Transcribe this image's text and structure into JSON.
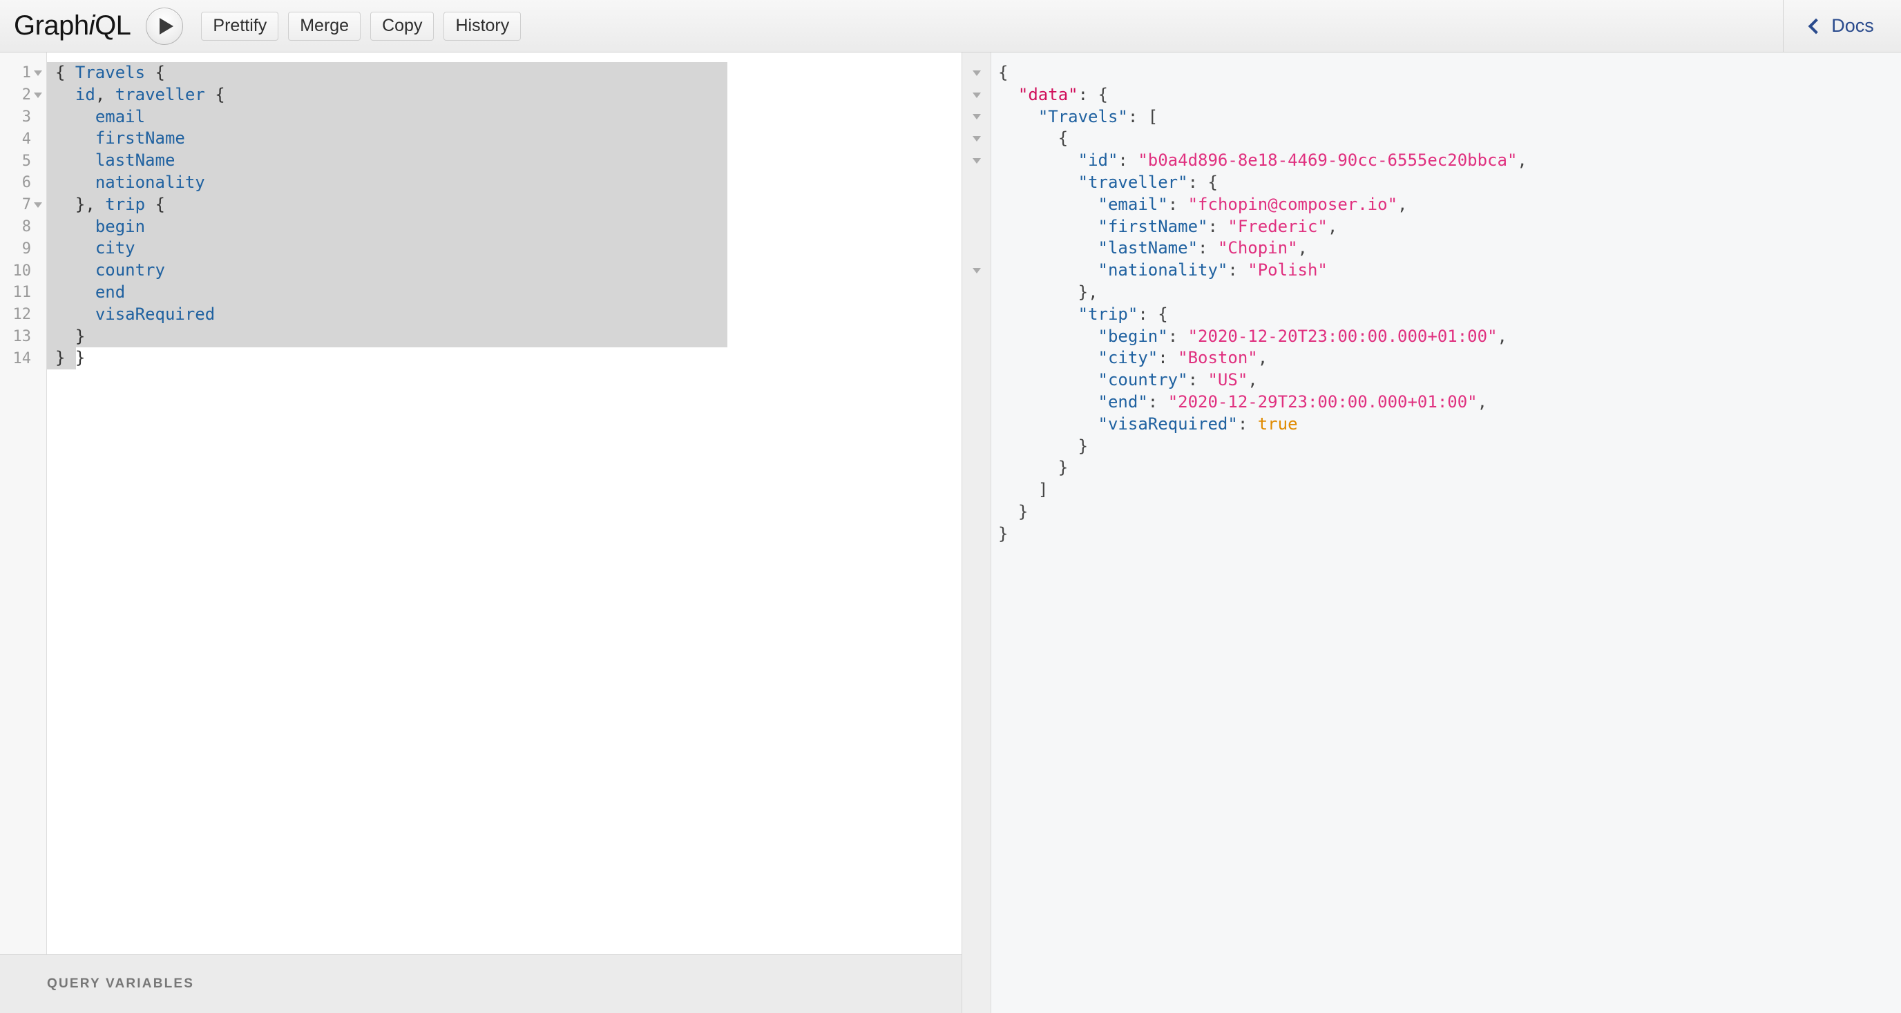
{
  "app": {
    "title_prefix": "Graph",
    "title_i": "i",
    "title_suffix": "QL"
  },
  "toolbar": {
    "execute_label": "",
    "buttons": [
      {
        "label": "Prettify",
        "name": "prettify-button"
      },
      {
        "label": "Merge",
        "name": "merge-button"
      },
      {
        "label": "Copy",
        "name": "copy-button"
      },
      {
        "label": "History",
        "name": "history-button"
      }
    ],
    "docs_label": "Docs"
  },
  "query_editor": {
    "line_numbers": [
      "1",
      "2",
      "3",
      "4",
      "5",
      "6",
      "7",
      "8",
      "9",
      "10",
      "11",
      "12",
      "13",
      "14"
    ],
    "fold_lines": [
      1,
      2,
      7
    ],
    "lines": [
      "{ Travels {",
      "  id, traveller {",
      "    email",
      "    firstName",
      "    lastName",
      "    nationality",
      "  }, trip {",
      "    begin",
      "    city",
      "    country",
      "    end",
      "    visaRequired",
      "  }",
      "} }"
    ],
    "selected_text": "{ Travels {\n  id, traveller {\n    email\n    firstName\n    lastName\n    nationality\n  }, trip {\n    begin\n    city\n    country\n    end\n    visaRequired\n  }\n}"
  },
  "query_variables": {
    "label": "QUERY VARIABLES"
  },
  "result_viewer": {
    "fold_lines": [
      1,
      2,
      3,
      4,
      5,
      10
    ],
    "lines": [
      "{",
      "  \"data\": {",
      "    \"Travels\": [",
      "      {",
      "        \"id\": \"b0a4d896-8e18-4469-90cc-6555ec20bbca\",",
      "        \"traveller\": {",
      "          \"email\": \"fchopin@composer.io\",",
      "          \"firstName\": \"Frederic\",",
      "          \"lastName\": \"Chopin\",",
      "          \"nationality\": \"Polish\"",
      "        },",
      "        \"trip\": {",
      "          \"begin\": \"2020-12-20T23:00:00.000+01:00\",",
      "          \"city\": \"Boston\",",
      "          \"country\": \"US\",",
      "          \"end\": \"2020-12-29T23:00:00.000+01:00\",",
      "          \"visaRequired\": true",
      "        }",
      "      }",
      "    ]",
      "  }",
      "}"
    ],
    "response": {
      "data": {
        "Travels": [
          {
            "id": "b0a4d896-8e18-4469-90cc-6555ec20bbca",
            "traveller": {
              "email": "fchopin@composer.io",
              "firstName": "Frederic",
              "lastName": "Chopin",
              "nationality": "Polish"
            },
            "trip": {
              "begin": "2020-12-20T23:00:00.000+01:00",
              "city": "Boston",
              "country": "US",
              "end": "2020-12-29T23:00:00.000+01:00",
              "visaRequired": true
            }
          }
        ]
      }
    }
  },
  "colors": {
    "field": "#1f61a0",
    "json_key": "#1f61a0",
    "json_key_data": "#d10f5b",
    "json_string": "#e0307f",
    "json_boolean": "#e08b00",
    "docs_link": "#2a4b8d",
    "selection": "#d6d6d6"
  }
}
